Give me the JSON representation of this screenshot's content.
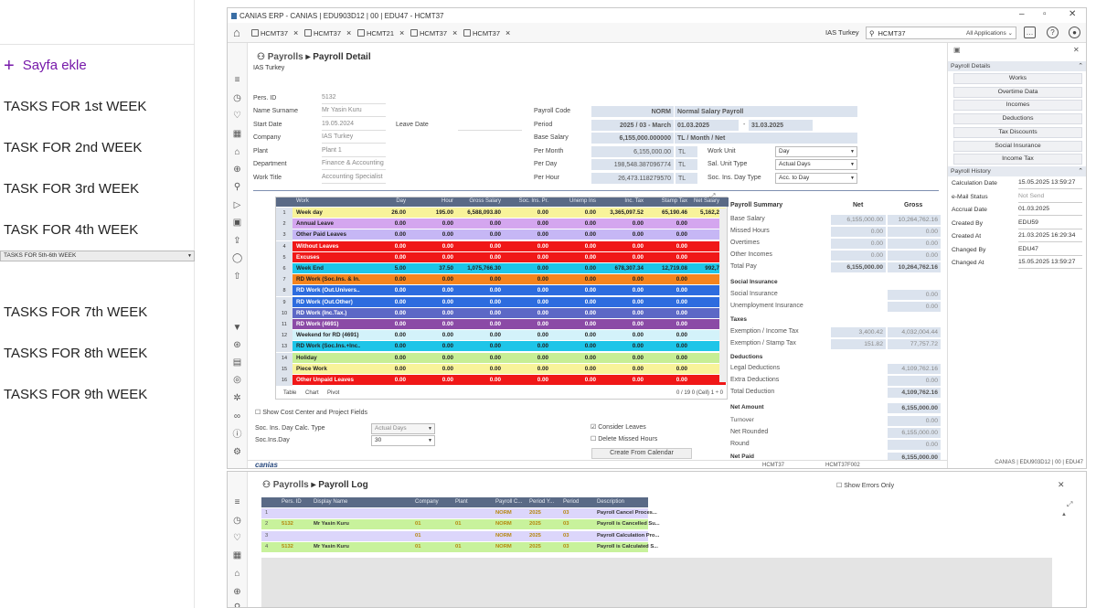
{
  "sidebar": {
    "add_page": "Sayfa ekle",
    "items": [
      "TASKS FOR 1st WEEK",
      "TASK FOR 2nd WEEK",
      "TASK FOR 3rd WEEK",
      "TASK FOR 4th WEEK",
      "TASKS FOR 5th-6th WEEK",
      "TASKS FOR 7th WEEK",
      "TASKS FOR 8th WEEK",
      "TASKS FOR 9th WEEK"
    ],
    "selected_index": 4
  },
  "window": {
    "title": "CANIAS ERP - CANIAS | EDU903D12 | 00 | EDU47 - HCMT37",
    "tabs": [
      "HCMT37",
      "HCMT37",
      "HCMT21",
      "HCMT37",
      "HCMT37"
    ],
    "company": "IAS Turkey",
    "search_value": "HCMT37",
    "apps_label": "All Applications"
  },
  "page": {
    "module": "Payrolls",
    "title": "Payroll Detail",
    "subtitle": "IAS Turkey"
  },
  "info": {
    "pers_id_label": "Pers. ID",
    "pers_id": "5132",
    "name_label": "Name Surname",
    "name": "Mr Yasin Kuru",
    "start_label": "Start Date",
    "start": "19.05.2024",
    "leave_label": "Leave Date",
    "company_label": "Company",
    "company": "IAS Turkey",
    "plant_label": "Plant",
    "plant": "Plant 1",
    "dept_label": "Department",
    "dept": "Finance & Accounting",
    "title_label": "Work Title",
    "title": "Accounting Specialist",
    "pcode_label": "Payroll Code",
    "pcode": "NORM",
    "pcode_desc": "Normal Salary Payroll",
    "period_label": "Period",
    "period": "2025 / 03 - March",
    "period_from": "01.03.2025",
    "period_sep": "-",
    "period_to": "31.03.2025",
    "base_label": "Base Salary",
    "base": "6,155,000.000000",
    "base_unit": "TL / Month / Net",
    "pm_label": "Per Month",
    "pm": "6,155,000.00",
    "pd_label": "Per Day",
    "pd": "198,548.387096774",
    "ph_label": "Per Hour",
    "ph": "26,473.118279570",
    "cur": "TL",
    "wu_label": "Work Unit",
    "wu": "Day",
    "su_label": "Sal. Unit Type",
    "su": "Actual Days",
    "sd_label": "Soc. Ins. Day Type",
    "sd": "Acc. to Day"
  },
  "grid": {
    "headers": [
      "Work",
      "Day",
      "Hour",
      "Gross Salary",
      "Soc. Ins. Pr.",
      "Unemp Ins",
      "Inc. Tax",
      "Stamp Tax",
      "Net Salary"
    ],
    "rows": [
      {
        "n": "1",
        "name": "Week day",
        "day": "26.00",
        "hour": "195.00",
        "gross": "6,588,093.80",
        "soc": "0.00",
        "unemp": "0.00",
        "inc": "3,365,097.52",
        "stamp": "65,190.46",
        "net": "5,162,2",
        "bg": "#f8f39a"
      },
      {
        "n": "2",
        "name": "Annual Leave",
        "day": "0.00",
        "hour": "0.00",
        "gross": "0.00",
        "soc": "0.00",
        "unemp": "0.00",
        "inc": "0.00",
        "stamp": "0.00",
        "net": "",
        "bg": "#d4a6ef"
      },
      {
        "n": "3",
        "name": "Other Paid Leaves",
        "day": "0.00",
        "hour": "0.00",
        "gross": "0.00",
        "soc": "0.00",
        "unemp": "0.00",
        "inc": "0.00",
        "stamp": "0.00",
        "net": "",
        "bg": "#c6b7f5"
      },
      {
        "n": "4",
        "name": "Without Leaves",
        "day": "0.00",
        "hour": "0.00",
        "gross": "0.00",
        "soc": "0.00",
        "unemp": "0.00",
        "inc": "0.00",
        "stamp": "0.00",
        "net": "",
        "bg": "#f01818"
      },
      {
        "n": "5",
        "name": "Excuses",
        "day": "0.00",
        "hour": "0.00",
        "gross": "0.00",
        "soc": "0.00",
        "unemp": "0.00",
        "inc": "0.00",
        "stamp": "0.00",
        "net": "",
        "bg": "#f01818"
      },
      {
        "n": "6",
        "name": "Week End",
        "day": "5.00",
        "hour": "37.50",
        "gross": "1,075,766.30",
        "soc": "0.00",
        "unemp": "0.00",
        "inc": "678,307.34",
        "stamp": "12,719.08",
        "net": "992,7",
        "bg": "#1ec5e8"
      },
      {
        "n": "7",
        "name": "RD Work (Soc.Ins. & In...",
        "day": "0.00",
        "hour": "0.00",
        "gross": "0.00",
        "soc": "0.00",
        "unemp": "0.00",
        "inc": "0.00",
        "stamp": "0.00",
        "net": "",
        "bg": "#f5841e"
      },
      {
        "n": "8",
        "name": "RD Work (Out.Univers...",
        "day": "0.00",
        "hour": "0.00",
        "gross": "0.00",
        "soc": "0.00",
        "unemp": "0.00",
        "inc": "0.00",
        "stamp": "0.00",
        "net": "",
        "bg": "#2d6cdf"
      },
      {
        "n": "9",
        "name": "RD Work (Out.Other)",
        "day": "0.00",
        "hour": "0.00",
        "gross": "0.00",
        "soc": "0.00",
        "unemp": "0.00",
        "inc": "0.00",
        "stamp": "0.00",
        "net": "",
        "bg": "#2d6cdf"
      },
      {
        "n": "10",
        "name": "RD Work (Inc.Tax.)",
        "day": "0.00",
        "hour": "0.00",
        "gross": "0.00",
        "soc": "0.00",
        "unemp": "0.00",
        "inc": "0.00",
        "stamp": "0.00",
        "net": "",
        "bg": "#5c68c6"
      },
      {
        "n": "11",
        "name": "RD Work (4691)",
        "day": "0.00",
        "hour": "0.00",
        "gross": "0.00",
        "soc": "0.00",
        "unemp": "0.00",
        "inc": "0.00",
        "stamp": "0.00",
        "net": "",
        "bg": "#8b4aa6"
      },
      {
        "n": "12",
        "name": "Weekend for RD (4691)",
        "day": "0.00",
        "hour": "0.00",
        "gross": "0.00",
        "soc": "0.00",
        "unemp": "0.00",
        "inc": "0.00",
        "stamp": "0.00",
        "net": "",
        "bg": "#d3f2fa"
      },
      {
        "n": "13",
        "name": "RD Work (Soc.Ins.+Inc...",
        "day": "0.00",
        "hour": "0.00",
        "gross": "0.00",
        "soc": "0.00",
        "unemp": "0.00",
        "inc": "0.00",
        "stamp": "0.00",
        "net": "",
        "bg": "#1ec5e8"
      },
      {
        "n": "14",
        "name": "Holiday",
        "day": "0.00",
        "hour": "0.00",
        "gross": "0.00",
        "soc": "0.00",
        "unemp": "0.00",
        "inc": "0.00",
        "stamp": "0.00",
        "net": "",
        "bg": "#c7ee95"
      },
      {
        "n": "15",
        "name": "Piece Work",
        "day": "0.00",
        "hour": "0.00",
        "gross": "0.00",
        "soc": "0.00",
        "unemp": "0.00",
        "inc": "0.00",
        "stamp": "0.00",
        "net": "",
        "bg": "#f8f39a"
      },
      {
        "n": "16",
        "name": "Other Unpaid Leaves",
        "day": "0.00",
        "hour": "0.00",
        "gross": "0.00",
        "soc": "0.00",
        "unemp": "0.00",
        "inc": "0.00",
        "stamp": "0.00",
        "net": "",
        "bg": "#f01818"
      }
    ],
    "footer_tabs": [
      "Table",
      "Chart",
      "Pivot"
    ],
    "footer_info": "0 / 19  0 (Cell)  1 ÷ 0"
  },
  "options": {
    "show_cc": "Show Cost Center and Project Fields",
    "soc_calc_label": "Soc. Ins. Day Calc. Type",
    "soc_calc": "Actual Days",
    "soc_day_label": "Soc.Ins.Day",
    "soc_day": "30",
    "consider": "Consider Leaves",
    "delete_missed": "Delete Missed Hours",
    "create_btn": "Create From Calendar"
  },
  "summary": {
    "title": "Payroll Summary",
    "net_h": "Net",
    "gross_h": "Gross",
    "rows": [
      {
        "k": "Base Salary",
        "net": "6,155,000.00",
        "gross": "10,264,762.16",
        "bold": false
      },
      {
        "k": "Missed Hours",
        "net": "0.00",
        "gross": "0.00",
        "bold": false
      },
      {
        "k": "Overtimes",
        "net": "0.00",
        "gross": "0.00",
        "bold": false
      },
      {
        "k": "Other Incomes",
        "net": "0.00",
        "gross": "0.00",
        "bold": false
      },
      {
        "k": "Total Pay",
        "net": "6,155,000.00",
        "gross": "10,264,762.16",
        "bold": true
      }
    ],
    "si_h": "Social Insurance",
    "si": "Social Insurance",
    "si_v": "0.00",
    "ui": "Unemployment Insurance",
    "ui_v": "0.00",
    "tax_h": "Taxes",
    "inc_tax": "Exemption / Income Tax",
    "inc_tax_net": "3,400.42",
    "inc_tax_gross": "4,032,004.44",
    "st_tax": "Exemption / Stamp Tax",
    "st_tax_net": "151.82",
    "st_tax_gross": "77,757.72",
    "ded_h": "Deductions",
    "legal": "Legal Deductions",
    "legal_v": "4,109,762.16",
    "extra": "Extra Deductions",
    "extra_v": "0.00",
    "total_ded": "Total Deduction",
    "total_ded_v": "4,109,762.16",
    "net_amt": "Net Amount",
    "net_amt_v": "6,155,000.00",
    "turnover": "Turnover",
    "turnover_v": "0.00",
    "rounded": "Net Rounded",
    "rounded_v": "6,155,000.00",
    "round": "Round",
    "round_v": "0.00",
    "net_paid": "Net Paid",
    "net_paid_v": "6,155,000.00"
  },
  "right": {
    "details_h": "Payroll Details",
    "buttons": [
      "Works",
      "Overtime Data",
      "Incomes",
      "Deductions",
      "Tax Discounts",
      "Social Insurance",
      "Income Tax"
    ],
    "history_h": "Payroll History",
    "hist": [
      {
        "k": "Calculation Date",
        "v": "15.05.2025 13:59:27"
      },
      {
        "k": "e-Mail Status",
        "v": "Not Send"
      },
      {
        "k": "Accrual Date",
        "v": "01.03.2025"
      },
      {
        "k": "Created By",
        "v": "EDU59"
      },
      {
        "k": "Created At",
        "v": "21.03.2025 16:29:34"
      },
      {
        "k": "Changed By",
        "v": "EDU47"
      },
      {
        "k": "Changed At",
        "v": "15.05.2025 13:59:27"
      }
    ]
  },
  "statusbar": {
    "brand": "canias",
    "app": "HCMT37",
    "screen": "HCMT37F002",
    "session": "CANIAS | EDU903D12 | 00 | EDU47"
  },
  "log": {
    "module": "Payrolls",
    "title": "Payroll Log",
    "show_errors": "Show Errors Only",
    "headers": [
      "Pers. ID",
      "Display Name",
      "Company",
      "Plant",
      "Payroll C...",
      "Period Y...",
      "Period",
      "Description"
    ],
    "rows": [
      {
        "n": "1",
        "id": "",
        "name": "",
        "company": "",
        "plant": "",
        "code": "NORM",
        "year": "2025",
        "period": "03",
        "desc": "Payroll Cancel Proces...",
        "bg": "#dcd6fb"
      },
      {
        "n": "2",
        "id": "5132",
        "name": "Mr Yasin Kuru",
        "company": "01",
        "plant": "01",
        "code": "NORM",
        "year": "2025",
        "period": "03",
        "desc": "Payroll is Cancelled Su...",
        "bg": "#c8f29c"
      },
      {
        "n": "3",
        "id": "",
        "name": "",
        "company": "01",
        "plant": "",
        "code": "NORM",
        "year": "2025",
        "period": "03",
        "desc": "Payroll Calculation Pro...",
        "bg": "#dcd6fb"
      },
      {
        "n": "4",
        "id": "5132",
        "name": "Mr Yasin Kuru",
        "company": "01",
        "plant": "01",
        "code": "NORM",
        "year": "2025",
        "period": "03",
        "desc": "Payroll is Calculated S...",
        "bg": "#c8f29c"
      }
    ]
  }
}
